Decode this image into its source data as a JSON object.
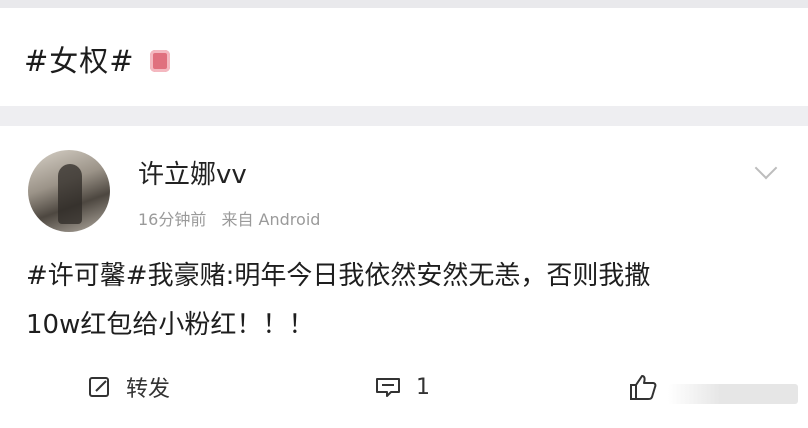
{
  "topic": {
    "title": "#女权#"
  },
  "post": {
    "username": "许立娜vv",
    "time": "16分钟前",
    "source": "来自 Android",
    "content_line1": "#许可馨#我豪赌:明年今日我依然安然无恙，否则我撒",
    "content_line2": "10w红包给小粉红！！！"
  },
  "actions": {
    "repost_label": "转发",
    "comment_count": "1"
  },
  "icons": {
    "repost": "edit-square-icon",
    "comment": "comment-bubble-icon",
    "like": "thumbs-up-icon",
    "menu": "chevron-down-icon"
  }
}
